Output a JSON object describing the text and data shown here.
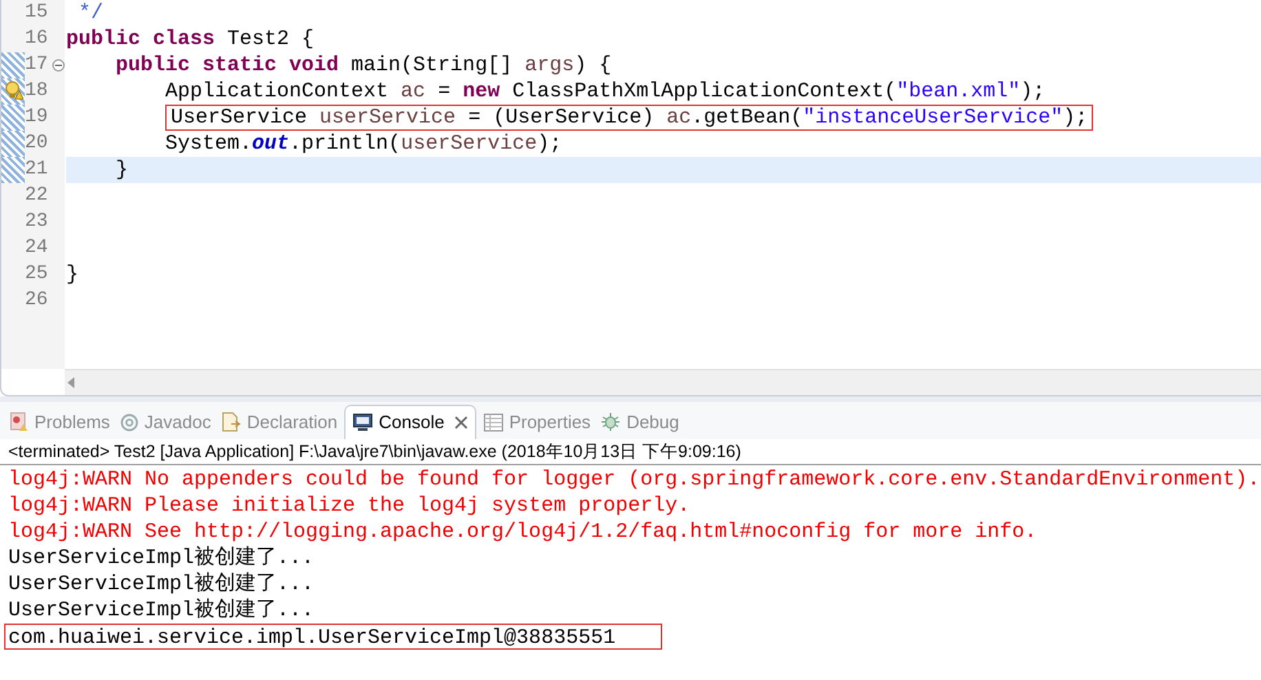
{
  "editor": {
    "lines": [
      {
        "number": "15",
        "highlighted": false,
        "boxed": false,
        "tokens": [
          {
            "kind": "comment",
            "text": " */"
          }
        ]
      },
      {
        "number": "16",
        "highlighted": false,
        "boxed": false,
        "tokens": [
          {
            "kind": "keyword",
            "text": "public class"
          },
          {
            "kind": "plain",
            "text": " Test2 {"
          }
        ]
      },
      {
        "number": "17",
        "highlighted": false,
        "boxed": false,
        "tokens": [
          {
            "kind": "keyword",
            "text": "    public static void"
          },
          {
            "kind": "plain",
            "text": " main(String[] "
          },
          {
            "kind": "variable",
            "text": "args"
          },
          {
            "kind": "plain",
            "text": ") {"
          }
        ]
      },
      {
        "number": "18",
        "highlighted": false,
        "boxed": false,
        "tokens": [
          {
            "kind": "plain",
            "text": "        ApplicationContext "
          },
          {
            "kind": "variable",
            "text": "ac"
          },
          {
            "kind": "plain",
            "text": " = "
          },
          {
            "kind": "keyword",
            "text": "new"
          },
          {
            "kind": "plain",
            "text": " ClassPathXmlApplicationContext("
          },
          {
            "kind": "string",
            "text": "\"bean.xml\""
          },
          {
            "kind": "plain",
            "text": ");"
          }
        ]
      },
      {
        "number": "19",
        "highlighted": false,
        "boxed": true,
        "tokens": [
          {
            "kind": "plain",
            "text": "        UserService "
          },
          {
            "kind": "variable",
            "text": "userService"
          },
          {
            "kind": "plain",
            "text": " = (UserService) "
          },
          {
            "kind": "variable",
            "text": "ac"
          },
          {
            "kind": "plain",
            "text": ".getBean("
          },
          {
            "kind": "string",
            "text": "\"instanceUserService\""
          },
          {
            "kind": "plain",
            "text": ");"
          }
        ]
      },
      {
        "number": "20",
        "highlighted": false,
        "boxed": false,
        "tokens": [
          {
            "kind": "plain",
            "text": "        System."
          },
          {
            "kind": "field",
            "text": "out"
          },
          {
            "kind": "plain",
            "text": ".println("
          },
          {
            "kind": "variable",
            "text": "userService"
          },
          {
            "kind": "plain",
            "text": ");"
          }
        ]
      },
      {
        "number": "21",
        "highlighted": true,
        "boxed": false,
        "tokens": [
          {
            "kind": "plain",
            "text": "    }"
          }
        ]
      },
      {
        "number": "22",
        "highlighted": false,
        "boxed": false
      },
      {
        "number": "23",
        "highlighted": false,
        "boxed": false
      },
      {
        "number": "24",
        "highlighted": false,
        "boxed": false
      },
      {
        "number": "25",
        "highlighted": false,
        "boxed": false,
        "tokens": [
          {
            "kind": "plain",
            "text": "}"
          }
        ]
      },
      {
        "number": "26",
        "highlighted": false,
        "boxed": false
      }
    ]
  },
  "tabs": [
    {
      "label": "Problems",
      "selected": false
    },
    {
      "label": "Javadoc",
      "selected": false
    },
    {
      "label": "Declaration",
      "selected": false
    },
    {
      "label": "Console",
      "selected": true
    },
    {
      "label": "Properties",
      "selected": false
    },
    {
      "label": "Debug",
      "selected": false
    }
  ],
  "console": {
    "status": "<terminated> Test2 [Java Application] F:\\Java\\jre7\\bin\\javaw.exe (2018年10月13日 下午9:09:16)",
    "lines": [
      {
        "kind": "error",
        "boxed": false,
        "text": "log4j:WARN No appenders could be found for logger (org.springframework.core.env.StandardEnvironment)."
      },
      {
        "kind": "error",
        "boxed": false,
        "text": "log4j:WARN Please initialize the log4j system properly."
      },
      {
        "kind": "error",
        "boxed": false,
        "text": "log4j:WARN See http://logging.apache.org/log4j/1.2/faq.html#noconfig for more info."
      },
      {
        "kind": "output",
        "boxed": false,
        "text": "UserServiceImpl被创建了..."
      },
      {
        "kind": "output",
        "boxed": false,
        "text": "UserServiceImpl被创建了..."
      },
      {
        "kind": "output",
        "boxed": false,
        "text": "UserServiceImpl被创建了..."
      },
      {
        "kind": "output",
        "boxed": true,
        "text": "com.huaiwei.service.impl.UserServiceImpl@38835551"
      }
    ]
  }
}
